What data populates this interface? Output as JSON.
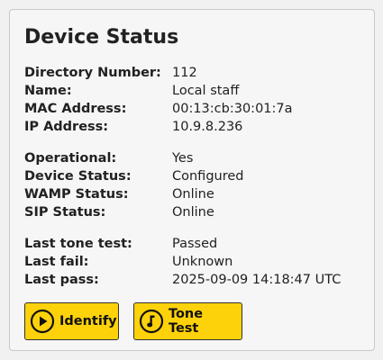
{
  "title": "Device Status",
  "device": {
    "rows": [
      {
        "label": "Directory Number:",
        "value": "112"
      },
      {
        "label": "Name:",
        "value": "Local staff"
      },
      {
        "label": "MAC Address:",
        "value": "00:13:cb:30:01:7a"
      },
      {
        "label": "IP Address:",
        "value": "10.9.8.236"
      }
    ]
  },
  "status": {
    "rows": [
      {
        "label": "Operational:",
        "value": "Yes"
      },
      {
        "label": "Device Status:",
        "value": "Configured"
      },
      {
        "label": "WAMP Status:",
        "value": "Online"
      },
      {
        "label": "SIP Status:",
        "value": "Online"
      }
    ]
  },
  "tone": {
    "rows": [
      {
        "label": "Last tone test:",
        "value": "Passed"
      },
      {
        "label": "Last fail:",
        "value": "Unknown"
      },
      {
        "label": "Last pass:",
        "value": "2025-09-09 14:18:47 UTC"
      }
    ]
  },
  "buttons": {
    "identify": {
      "label": "Identify",
      "icon": "play-circle-icon"
    },
    "tone_test": {
      "label": "Tone Test",
      "icon": "music-note-circle-icon"
    }
  },
  "colors": {
    "button_fill": "#fdd20a",
    "card_background": "#f6f6f6",
    "page_background": "#f1f1f1"
  }
}
